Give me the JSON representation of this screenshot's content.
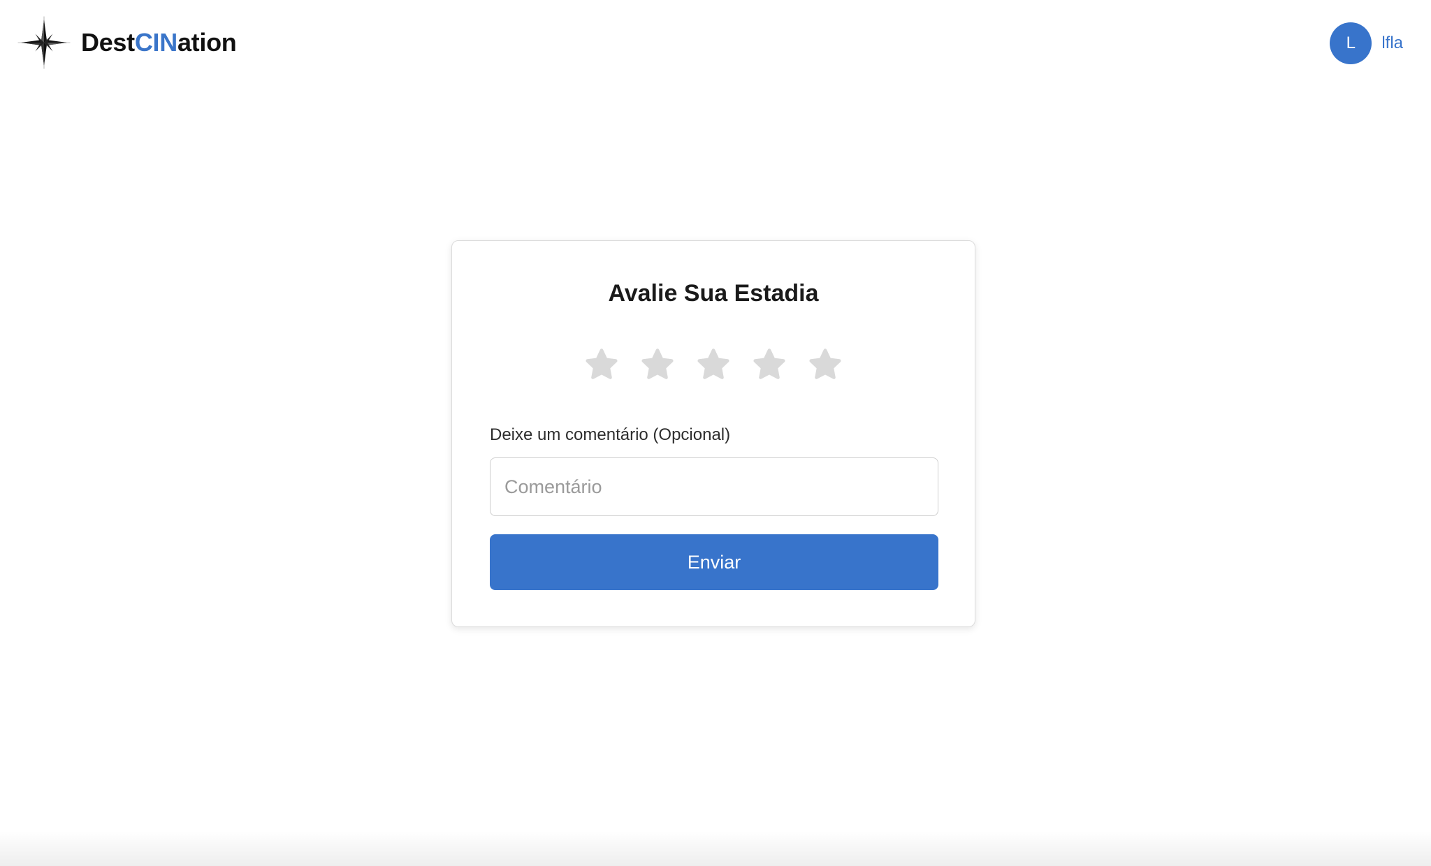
{
  "header": {
    "brand_part1": "Dest",
    "brand_accent": "CIN",
    "brand_part2": "ation",
    "logo_icon": "compass-star-icon",
    "user_initial": "L",
    "user_name": "lfla"
  },
  "rating_card": {
    "title": "Avalie Sua Estadia",
    "rating": {
      "value": 0,
      "max": 5,
      "star_icon": "star-icon",
      "empty_color": "#d9d9d9"
    },
    "comment_label": "Deixe um comentário (Opcional)",
    "comment_value": "",
    "comment_placeholder": "Comentário",
    "submit_label": "Enviar"
  },
  "colors": {
    "accent": "#3874cb",
    "text_dark": "#111111",
    "border": "#dcdcdc"
  }
}
